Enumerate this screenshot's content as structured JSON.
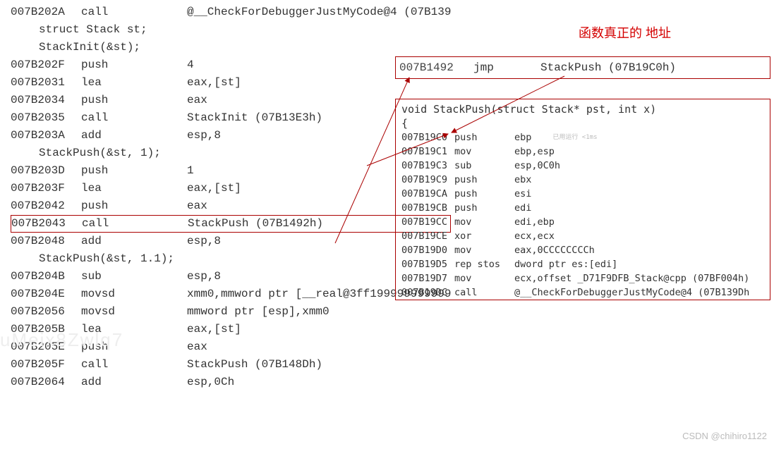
{
  "annotation": {
    "real_address_label": "函数真正的 地址"
  },
  "disasm_left": [
    {
      "type": "asm",
      "addr": "007B202A",
      "mnem": "call",
      "op": "@__CheckForDebuggerJustMyCode@4 (07B139"
    },
    {
      "type": "src",
      "text": "struct Stack st;"
    },
    {
      "type": "src",
      "text": "StackInit(&st);"
    },
    {
      "type": "asm",
      "addr": "007B202F",
      "mnem": "push",
      "op": "4"
    },
    {
      "type": "asm",
      "addr": "007B2031",
      "mnem": "lea",
      "op": "eax,[st]"
    },
    {
      "type": "asm",
      "addr": "007B2034",
      "mnem": "push",
      "op": "eax"
    },
    {
      "type": "asm",
      "addr": "007B2035",
      "mnem": "call",
      "op": "StackInit (07B13E3h)"
    },
    {
      "type": "asm",
      "addr": "007B203A",
      "mnem": "add",
      "op": "esp,8"
    },
    {
      "type": "src",
      "text": "StackPush(&st, 1);"
    },
    {
      "type": "asm",
      "addr": "007B203D",
      "mnem": "push",
      "op": "1"
    },
    {
      "type": "asm",
      "addr": "007B203F",
      "mnem": "lea",
      "op": "eax,[st]"
    },
    {
      "type": "asm",
      "addr": "007B2042",
      "mnem": "push",
      "op": "eax"
    },
    {
      "type": "asm",
      "addr": "007B2043",
      "mnem": "call",
      "op": "StackPush (07B1492h)",
      "highlight": true
    },
    {
      "type": "asm",
      "addr": "007B2048",
      "mnem": "add",
      "op": "esp,8"
    },
    {
      "type": "src",
      "text": "StackPush(&st, 1.1);"
    },
    {
      "type": "asm",
      "addr": "007B204B",
      "mnem": "sub",
      "op": "esp,8"
    },
    {
      "type": "asm",
      "addr": "007B204E",
      "mnem": "movsd",
      "op": "xmm0,mmword ptr [__real@3ff199999999999"
    },
    {
      "type": "asm",
      "addr": "007B2056",
      "mnem": "movsd",
      "op": "mmword ptr [esp],xmm0"
    },
    {
      "type": "asm",
      "addr": "007B205B",
      "mnem": "lea",
      "op": "eax,[st]"
    },
    {
      "type": "asm",
      "addr": "007B205E",
      "mnem": "push",
      "op": "eax"
    },
    {
      "type": "asm",
      "addr": "007B205F",
      "mnem": "call",
      "op": "StackPush (07B148Dh)"
    },
    {
      "type": "asm",
      "addr": "007B2064",
      "mnem": "add",
      "op": "esp,0Ch"
    }
  ],
  "jmp_line": {
    "addr": "007B1492",
    "mnem": "jmp",
    "op": "StackPush (07B19C0h)"
  },
  "func_box": {
    "header": "void StackPush(struct Stack* pst, int x)",
    "brace": "{",
    "rows": [
      {
        "addr": "007B19C0",
        "mnem": "push",
        "op": "ebp",
        "tiny": "已用运行 <1ms"
      },
      {
        "addr": "007B19C1",
        "mnem": "mov",
        "op": "ebp,esp"
      },
      {
        "addr": "007B19C3",
        "mnem": "sub",
        "op": "esp,0C0h"
      },
      {
        "addr": "007B19C9",
        "mnem": "push",
        "op": "ebx"
      },
      {
        "addr": "007B19CA",
        "mnem": "push",
        "op": "esi"
      },
      {
        "addr": "007B19CB",
        "mnem": "push",
        "op": "edi"
      },
      {
        "addr": "007B19CC",
        "mnem": "mov",
        "op": "edi,ebp"
      },
      {
        "addr": "007B19CE",
        "mnem": "xor",
        "op": "ecx,ecx"
      },
      {
        "addr": "007B19D0",
        "mnem": "mov",
        "op": "eax,0CCCCCCCCh"
      },
      {
        "addr": "007B19D5",
        "mnem": "rep stos",
        "op": "dword ptr es:[edi]"
      },
      {
        "addr": "007B19D7",
        "mnem": "mov",
        "op": "ecx,offset _D71F9DFB_Stack@cpp (07BF004h)"
      },
      {
        "addr": "007B19DC",
        "mnem": "call",
        "op": "@__CheckForDebuggerJustMyCode@4 (07B139Dh"
      }
    ]
  },
  "watermarks": {
    "csdn": "CSDN @chihiro1122",
    "left": "uMeix8Zwlq7"
  }
}
